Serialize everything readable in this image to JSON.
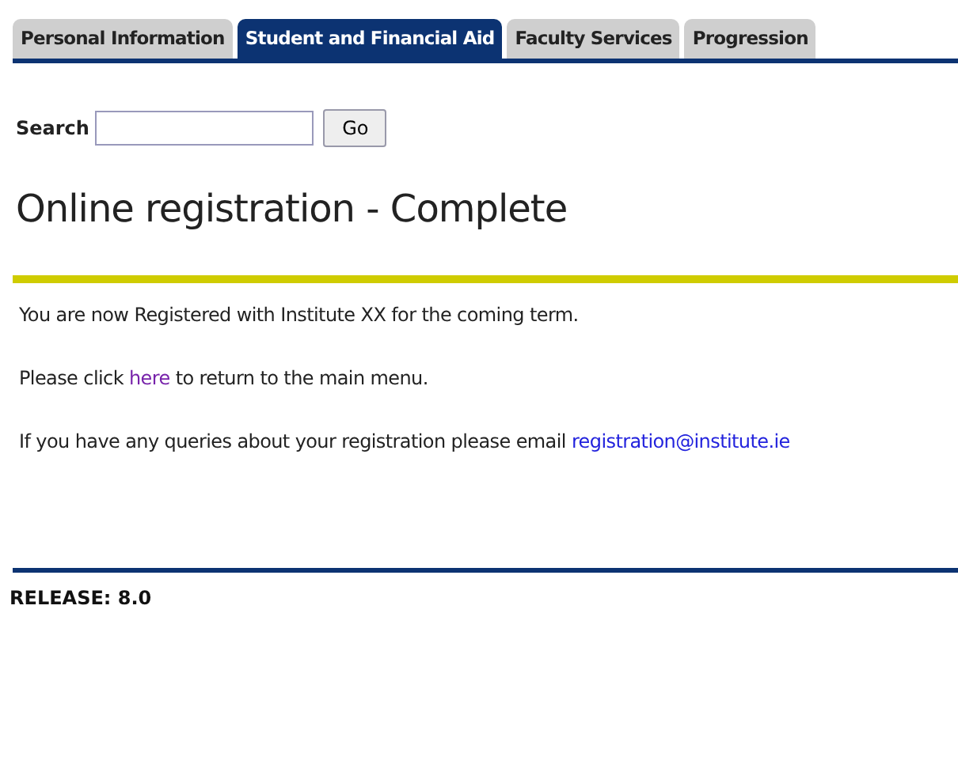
{
  "tabs": [
    {
      "label": "Personal Information",
      "selected": false
    },
    {
      "label": "Student and Financial Aid",
      "selected": true
    },
    {
      "label": "Faculty Services",
      "selected": false
    },
    {
      "label": "Progression",
      "selected": false
    }
  ],
  "search": {
    "label": "Search",
    "button": "Go"
  },
  "title": "Online registration - Complete",
  "messages": [
    {
      "parts": [
        {
          "text": "You are now Registered with Institute XX for the coming term.",
          "link": false
        }
      ]
    },
    {
      "parts": [
        {
          "text": "Please click ",
          "link": false
        },
        {
          "text": "here",
          "link": true,
          "visited": true
        },
        {
          "text": " to return to the main menu.",
          "link": false
        }
      ]
    },
    {
      "parts": [
        {
          "text": "If you have any queries about your registration please email ",
          "link": false
        },
        {
          "text": "registration@institute.ie",
          "link": true,
          "visited": false
        }
      ]
    }
  ],
  "release": "RELEASE: 8.0"
}
